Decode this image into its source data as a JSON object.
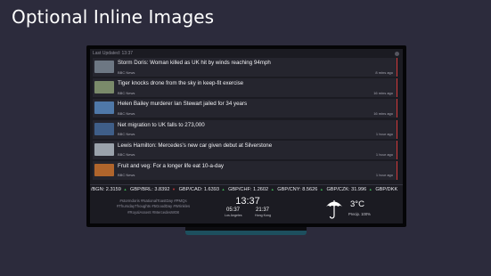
{
  "heading": "Optional Inline Images",
  "screen": {
    "last_updated": "Last Updated: 13:37"
  },
  "news": [
    {
      "headline": "Storm Doris: Woman killed as UK hit by winds reaching 94mph",
      "source": "BBC News",
      "time": "8 mins ago",
      "thumb_color": "#6d7783"
    },
    {
      "headline": "Tiger knocks drone from the sky in keep-fit exercise",
      "source": "BBC News",
      "time": "16 mins ago",
      "thumb_color": "#7a8a6a"
    },
    {
      "headline": "Helen Bailey murderer Ian Stewart jailed for 34 years",
      "source": "BBC News",
      "time": "16 mins ago",
      "thumb_color": "#4f78a8"
    },
    {
      "headline": "Net migration to UK falls to 273,000",
      "source": "BBC News",
      "time": "1 hour ago",
      "thumb_color": "#3f5e88"
    },
    {
      "headline": "Lewis Hamilton: Mercedes's new car given debut at Silverstone",
      "source": "BBC News",
      "time": "1 hour ago",
      "thumb_color": "#9aa2ab"
    },
    {
      "headline": "Fruit and veg: For a longer life eat 10-a-day",
      "source": "BBC News",
      "time": "1 hour ago",
      "thumb_color": "#b0652c"
    }
  ],
  "ticker": [
    {
      "text": "/BGN: 2.3159",
      "dir": "up"
    },
    {
      "text": "GBP/BRL: 3.8392",
      "dir": "down"
    },
    {
      "text": "GBP/CAD: 1.6393",
      "dir": "up"
    },
    {
      "text": "GBP/CHF: 1.2602",
      "dir": "up"
    },
    {
      "text": "GBP/CNY: 8.5626",
      "dir": "up"
    },
    {
      "text": "GBP/CZK: 31.996",
      "dir": "up"
    },
    {
      "text": "GBP/DKK",
      "dir": "none"
    }
  ],
  "tags": {
    "line1": "#stormdoris  #NationalToastDay  #PMQs",
    "line2": "#ThursdayThoughts  #5GoodDay  #Wrinkles",
    "line3": "#RoyalAssent  #MercedesW08"
  },
  "clock": {
    "main_time": "13:37",
    "time_la": "05:37",
    "time_hk": "21:37",
    "city_la": "Los Angeles",
    "city_hk": "Hong Kong"
  },
  "weather": {
    "temperature": "3°C",
    "precipitation": "Precip. 100%",
    "icon": "umbrella-icon"
  },
  "colors": {
    "background": "#2c2b3c",
    "accent": "#d23a3a",
    "up": "#3cae52",
    "down": "#d23a3a",
    "stand": "#1d4f5e"
  }
}
